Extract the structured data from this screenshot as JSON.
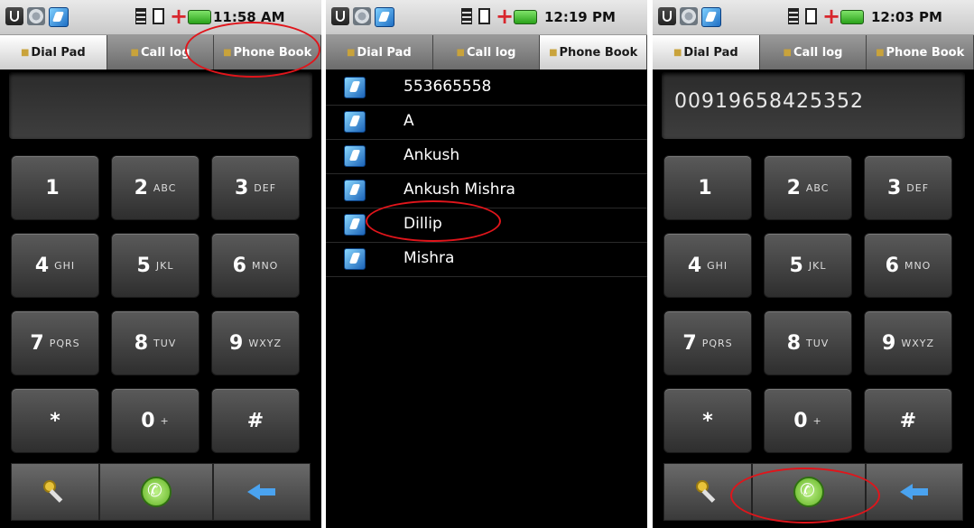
{
  "tabs": [
    "Dial Pad",
    "Call log",
    "Phone Book"
  ],
  "keys": [
    {
      "digit": "1",
      "letters": ""
    },
    {
      "digit": "2",
      "letters": "ABC"
    },
    {
      "digit": "3",
      "letters": "DEF"
    },
    {
      "digit": "4",
      "letters": "GHI"
    },
    {
      "digit": "5",
      "letters": "JKL"
    },
    {
      "digit": "6",
      "letters": "MNO"
    },
    {
      "digit": "7",
      "letters": "PQRS"
    },
    {
      "digit": "8",
      "letters": "TUV"
    },
    {
      "digit": "9",
      "letters": "WXYZ"
    },
    {
      "digit": "*",
      "letters": ""
    },
    {
      "digit": "0",
      "letters": "+"
    },
    {
      "digit": "#",
      "letters": ""
    }
  ],
  "screens": {
    "dialpad_empty": {
      "time": "11:58 AM",
      "active_tab": "Dial Pad",
      "display_value": ""
    },
    "phonebook": {
      "time": "12:19 PM",
      "active_tab": "Phone Book",
      "contacts": [
        "553665558",
        "A",
        "Ankush",
        "Ankush Mishra",
        "Dillip",
        "Mishra"
      ]
    },
    "dialpad_filled": {
      "time": "12:03 PM",
      "active_tab": "Dial Pad",
      "display_value": "00919658425352"
    }
  },
  "icons": {
    "bottom_left": "key-icon",
    "bottom_center": "call-icon",
    "bottom_right": "back-arrow-icon"
  },
  "colors": {
    "annotation": "#e0151b",
    "call_green": "#5fb21f",
    "back_blue": "#4aa3f0"
  }
}
